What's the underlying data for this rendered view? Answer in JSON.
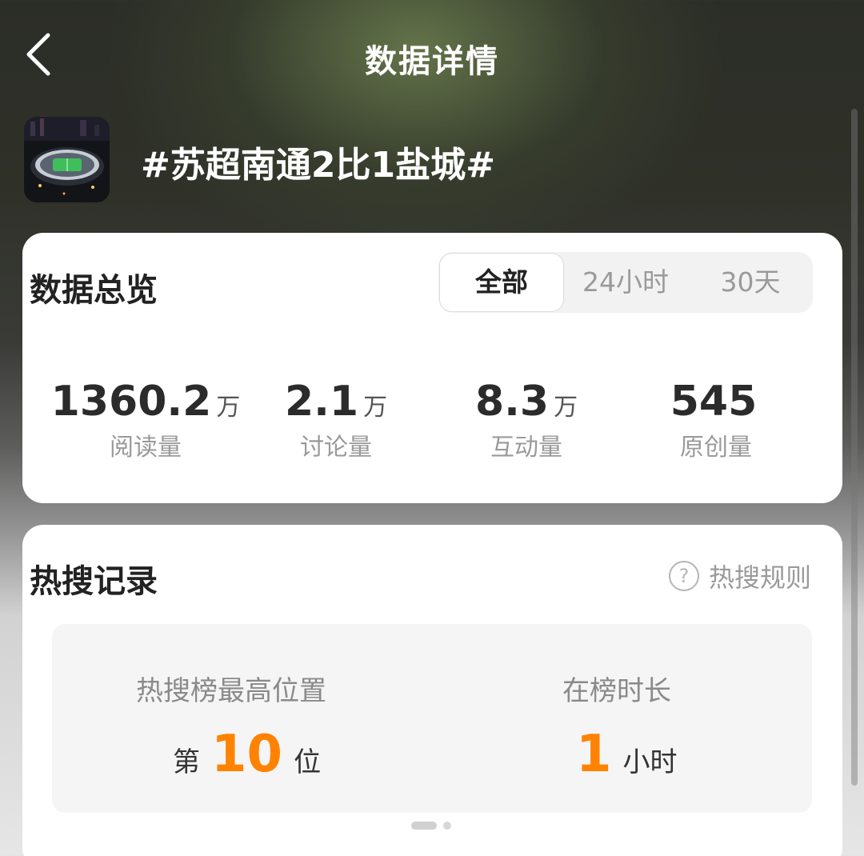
{
  "header": {
    "title": "数据详情"
  },
  "topic": {
    "name": "#苏超南通2比1盐城#",
    "thumbnail_icon": "stadium-night-photo"
  },
  "overview": {
    "title": "数据总览",
    "tabs": [
      {
        "label": "全部",
        "active": true
      },
      {
        "label": "24小时",
        "active": false
      },
      {
        "label": "30天",
        "active": false
      }
    ],
    "stats": [
      {
        "value": "1360.2",
        "unit": "万",
        "label": "阅读量"
      },
      {
        "value": "2.1",
        "unit": "万",
        "label": "讨论量"
      },
      {
        "value": "8.3",
        "unit": "万",
        "label": "互动量"
      },
      {
        "value": "545",
        "unit": "",
        "label": "原创量"
      }
    ]
  },
  "hot_search": {
    "title": "热搜记录",
    "rule_label": "热搜规则",
    "rule_icon": "question-circle-icon",
    "peak": {
      "label": "热搜榜最高位置",
      "prefix": "第",
      "value": "10",
      "suffix": "位"
    },
    "duration": {
      "label": "在榜时长",
      "value": "1",
      "suffix": "小时"
    }
  },
  "colors": {
    "accent": "#ff8200",
    "text_primary": "#222222",
    "text_secondary": "#9a9a9a",
    "card_background": "#ffffff"
  }
}
